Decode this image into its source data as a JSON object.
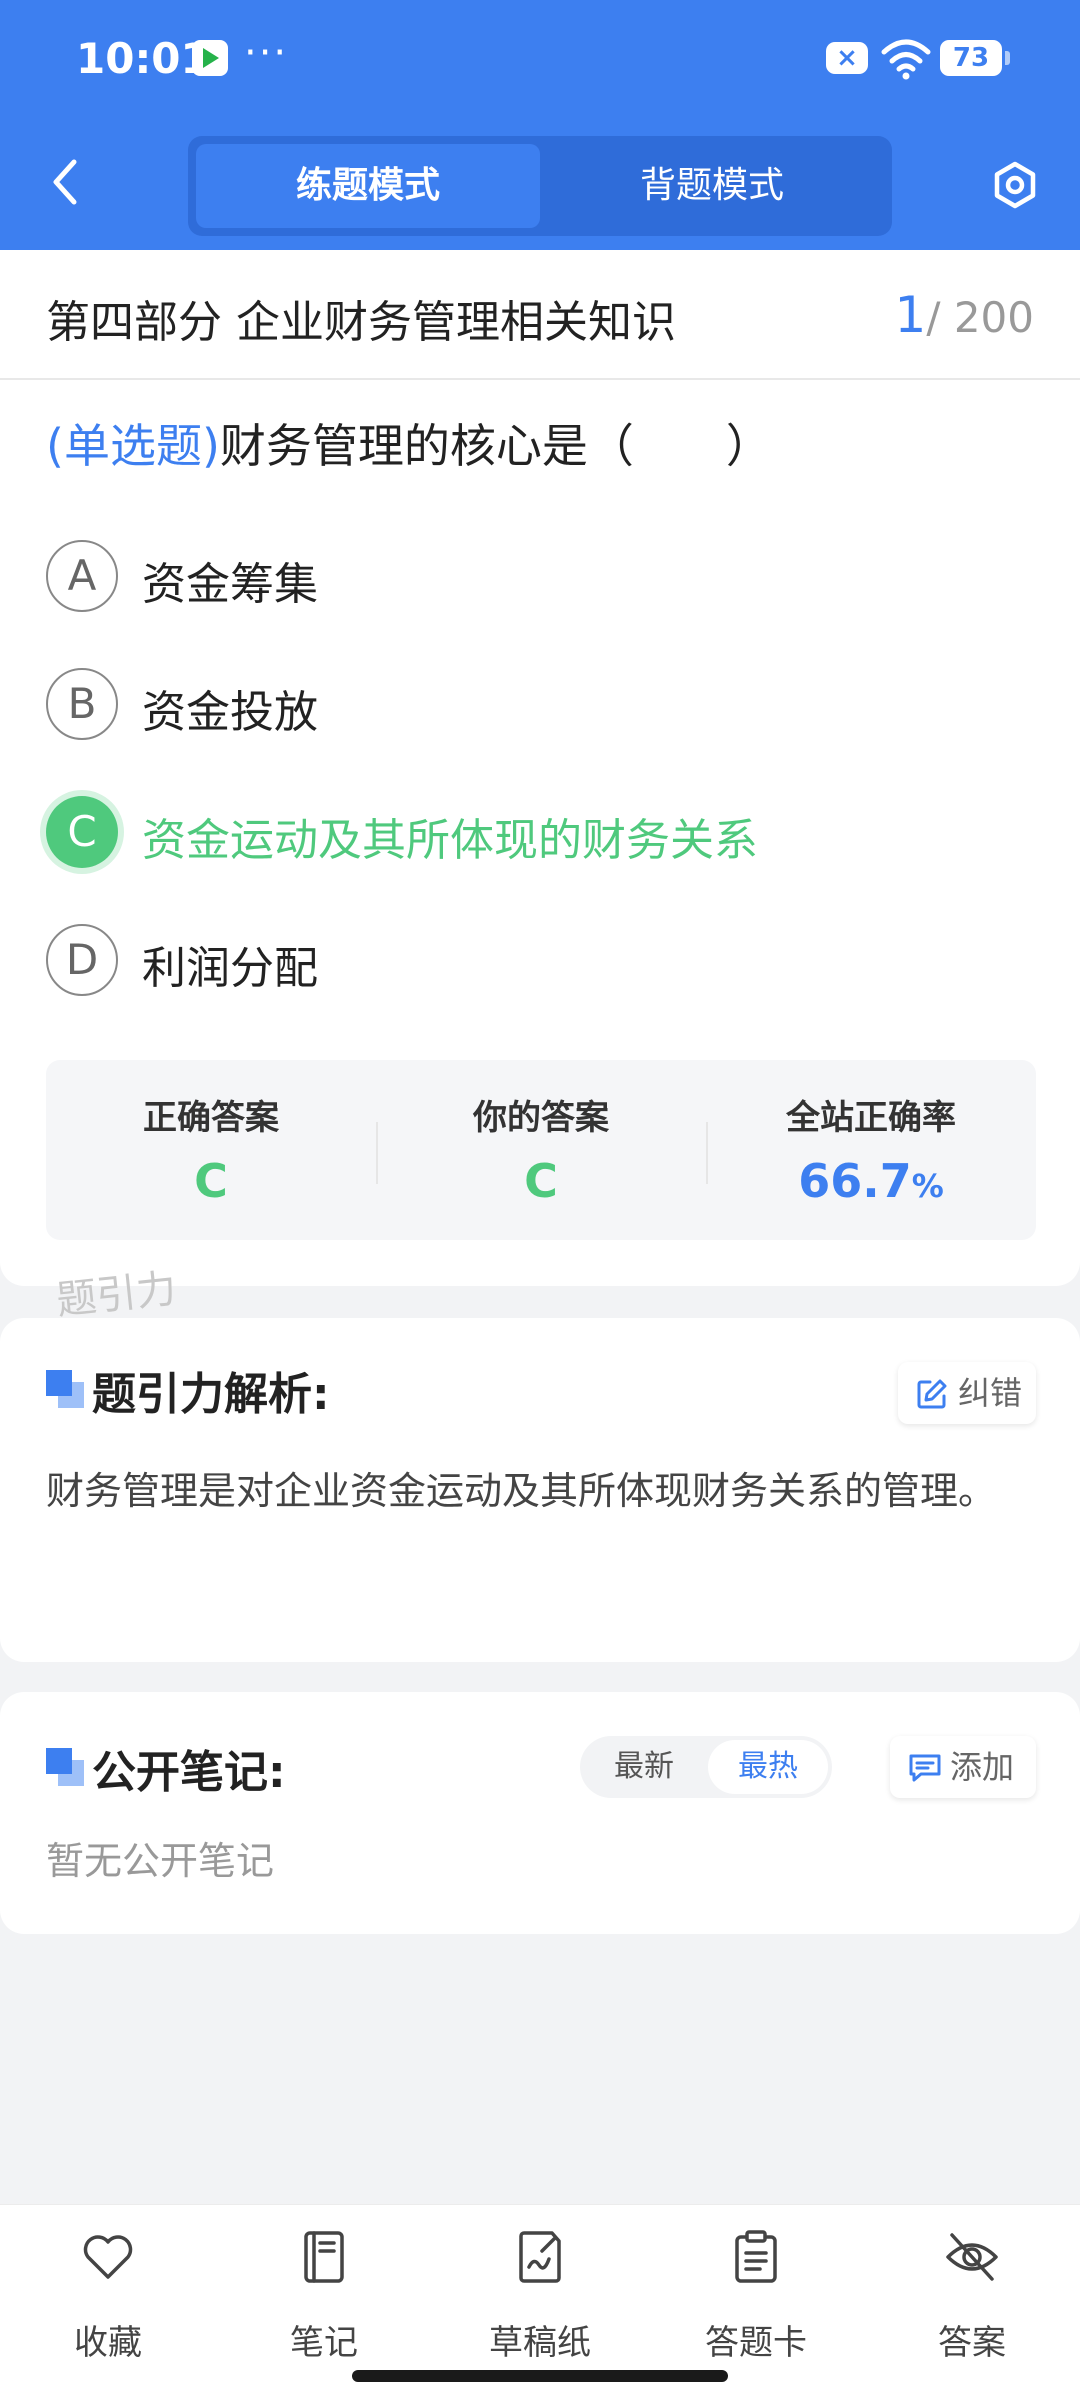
{
  "status_bar": {
    "time": "10:01",
    "more": "···",
    "notif_x": "×",
    "battery": "73"
  },
  "nav": {
    "modes": [
      "练题模式",
      "背题模式"
    ],
    "active_mode": "练题模式"
  },
  "question": {
    "section_title": "第四部分 企业财务管理相关知识",
    "progress_current": "1",
    "progress_total": "/ 200",
    "type_label": "(单选题)",
    "stem": "财务管理的核心是（　　）",
    "options": [
      {
        "letter": "A",
        "text": "资金筹集"
      },
      {
        "letter": "B",
        "text": "资金投放"
      },
      {
        "letter": "C",
        "text": "资金运动及其所体现的财务关系",
        "state": "correct"
      },
      {
        "letter": "D",
        "text": "利润分配"
      }
    ]
  },
  "stats": {
    "correct_label": "正确答案",
    "correct_value": "C",
    "your_label": "你的答案",
    "your_value": "C",
    "rate_label": "全站正确率",
    "rate_value": "66.7",
    "rate_unit": "%"
  },
  "watermark": "题引力",
  "analysis": {
    "title": "题引力解析:",
    "report_label": "纠错",
    "body": "财务管理是对企业资金运动及其所体现财务关系的管理。"
  },
  "notes": {
    "title": "公开笔记:",
    "sort_options": [
      "最新",
      "最热"
    ],
    "active_sort": "最热",
    "add_label": "添加",
    "empty_text": "暂无公开笔记"
  },
  "bottom_bar": [
    {
      "label": "收藏",
      "icon": "heart-icon"
    },
    {
      "label": "笔记",
      "icon": "notebook-icon"
    },
    {
      "label": "草稿纸",
      "icon": "draft-paper-icon"
    },
    {
      "label": "答题卡",
      "icon": "answer-sheet-icon"
    },
    {
      "label": "答案",
      "icon": "eye-off-icon"
    }
  ],
  "colors": {
    "brand": "#3d7ff0",
    "correct": "#4fc97d",
    "background": "#f2f3f5"
  }
}
